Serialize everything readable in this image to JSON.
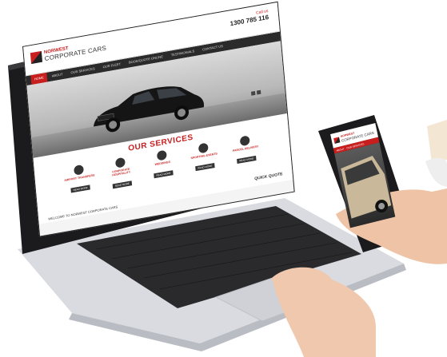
{
  "laptop_site": {
    "logo_top": "NORWEST",
    "logo_bottom": "CORPORATE CARS",
    "call_label": "Call us",
    "phone_number": "1300 785 116",
    "nav": [
      "HOME",
      "ABOUT",
      "OUR SERVICES",
      "OUR FLEET",
      "BOOK/QUOTE ONLINE",
      "TESTIMONIALS",
      "CONTACT US"
    ],
    "services_title": "OUR SERVICES",
    "services": [
      {
        "name": "AIRPORT TRANSFERS",
        "button": "READ MORE"
      },
      {
        "name": "CORPORATE HOSPITALITY",
        "button": "READ MORE"
      },
      {
        "name": "WEDDINGS",
        "button": "READ MORE"
      },
      {
        "name": "SPORTING EVENTS",
        "button": "READ MORE"
      },
      {
        "name": "PARCEL DELIVERY",
        "button": "READ MORE"
      }
    ],
    "quick_quote": "QUICK QUOTE",
    "welcome": "WELCOME TO NORWEST CORPORATE CARS"
  },
  "phone_site": {
    "logo_top": "NORWEST",
    "logo_bottom": "CORPORATE CARS",
    "nav": [
      "ABOUT",
      "OUR SERVICES"
    ]
  },
  "colors": {
    "brand_red": "#c81e1e",
    "nav_dark": "#2b2b2b"
  }
}
